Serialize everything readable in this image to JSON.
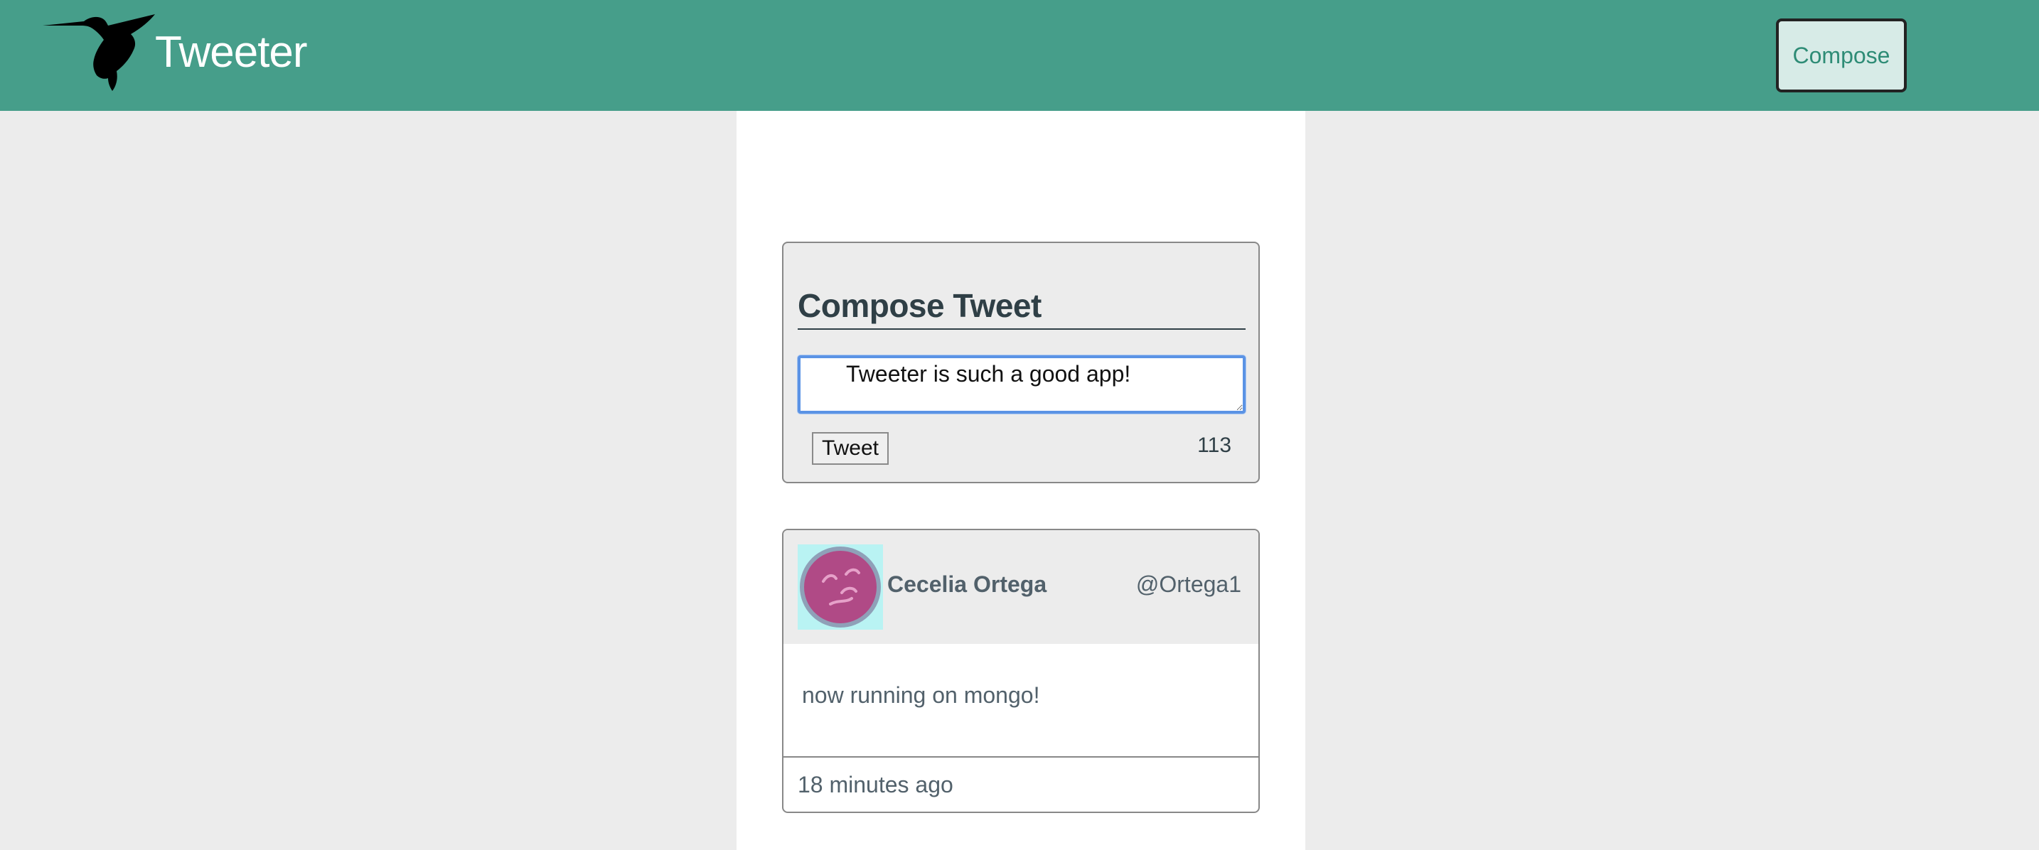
{
  "header": {
    "logo_icon": "hummingbird-logo-icon",
    "brand_title": "Tweeter",
    "compose_button_label": "Compose"
  },
  "compose": {
    "heading": "Compose Tweet",
    "textarea_value": "Tweeter is such a good app!",
    "tweet_button_label": "Tweet",
    "char_counter": "113"
  },
  "tweets": [
    {
      "avatar_icon": "user-avatar-icon",
      "author_name": "Cecelia Ortega",
      "author_handle": "@Ortega1",
      "body": "now running on mongo!",
      "timestamp": "18 minutes ago"
    }
  ],
  "colors": {
    "navbar_bg": "#469e8a",
    "page_bg": "#ececec",
    "text_primary": "#2f3f46",
    "accent_green": "#2e8c76",
    "avatar_bg": "#b9f3f3",
    "avatar_face": "#b04a86",
    "focus_ring": "#5b93e5"
  }
}
